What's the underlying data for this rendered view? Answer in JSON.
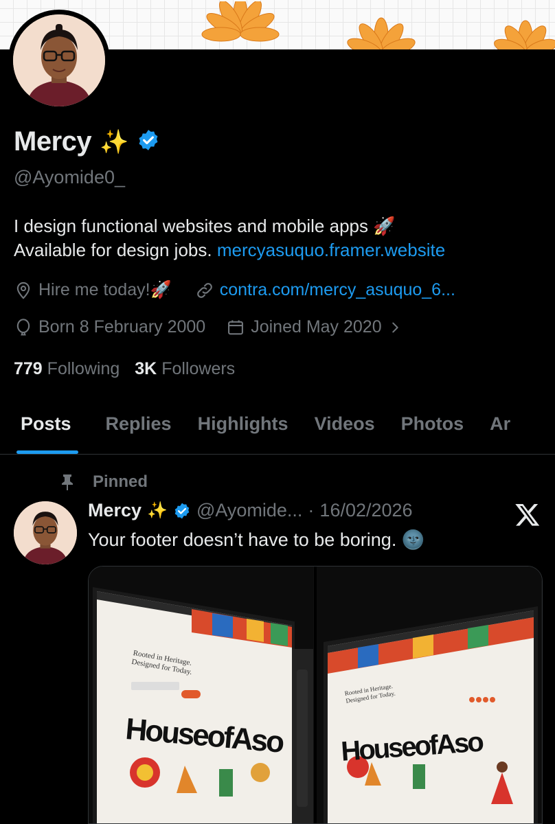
{
  "profile": {
    "name": "Mercy",
    "name_emoji": "✨",
    "handle": "@Ayomide0_",
    "bio_line1": "I design functional websites and mobile apps 🚀",
    "bio_line2": "Available for design jobs. ",
    "bio_link": "mercyasuquo.framer.website",
    "location": "Hire me today!🚀",
    "website": "contra.com/mercy_asuquo_6...",
    "birthday": "Born 8 February 2000",
    "joined": "Joined May 2020",
    "following_count": "779",
    "following_label": "Following",
    "followers_count": "3K",
    "followers_label": "Followers"
  },
  "tabs": [
    "Posts",
    "Replies",
    "Highlights",
    "Videos",
    "Photos",
    "Ar"
  ],
  "post": {
    "pinned_label": "Pinned",
    "author": "Mercy",
    "author_emoji": "✨",
    "handle": "@Ayomide...",
    "separator": "·",
    "date": "16/02/2026",
    "text": "Your footer doesn’t have to be boring. 🌚",
    "media": {
      "photo1_headline_1": "Rooted in Heritage.",
      "photo1_headline_2": "Designed for Today.",
      "photo1_brand": "HouseofAso",
      "photo2_headline_1": "Rooted in Heritage.",
      "photo2_headline_2": "Designed for Today.",
      "photo2_brand": "HouseofAso"
    }
  },
  "colors": {
    "accent": "#1d9bf0",
    "secondary_text": "#71767b",
    "primary_text": "#e7e9ea",
    "background": "#000000"
  },
  "icons": [
    "location-icon",
    "link-icon",
    "balloon-icon",
    "calendar-icon",
    "chevron-right-icon",
    "pin-icon",
    "verified-icon",
    "x-logo-icon"
  ]
}
